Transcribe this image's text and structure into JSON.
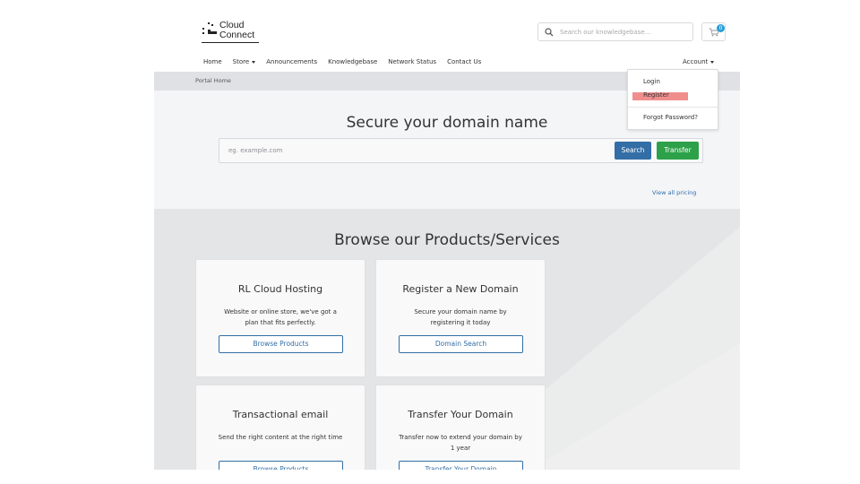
{
  "brand": {
    "name_line1": "Cloud",
    "name_line2": "Connect"
  },
  "header": {
    "search_placeholder": "Search our knowledgebase...",
    "cart_count": "0"
  },
  "nav": {
    "items": [
      "Home",
      "Store",
      "Announcements",
      "Knowledgebase",
      "Network Status",
      "Contact Us"
    ],
    "account_label": "Account"
  },
  "breadcrumb": {
    "current": "Portal Home"
  },
  "account_menu": {
    "items": [
      "Login",
      "Register",
      "Forgot Password?"
    ],
    "highlighted": "Register",
    "highlight_color": "#f08e8e"
  },
  "domain_search": {
    "title": "Secure your domain name",
    "placeholder": "eg. example.com",
    "search_label": "Search",
    "transfer_label": "Transfer",
    "pricing_link": "View all pricing"
  },
  "products": {
    "title": "Browse our Products/Services",
    "cards": [
      {
        "title": "RL Cloud Hosting",
        "description": "Website or online store, we've got a plan that fits perfectly.",
        "button": "Browse Products"
      },
      {
        "title": "Register a New Domain",
        "description": "Secure your domain name by registering it today",
        "button": "Domain Search"
      },
      {
        "title": "Transactional email",
        "description": "Send the right content at the right time",
        "button": "Browse Products"
      },
      {
        "title": "Transfer Your Domain",
        "description": "Transfer now to extend your domain by 1 year",
        "button": "Transfer Your Domain"
      }
    ]
  },
  "colors": {
    "primary": "#336ea6",
    "success": "#2da149",
    "link": "#2f6db0",
    "badge": "#2a9fd8"
  },
  "icons": [
    "logo-mark-icon",
    "search-icon",
    "cart-icon",
    "caret-down-icon"
  ]
}
